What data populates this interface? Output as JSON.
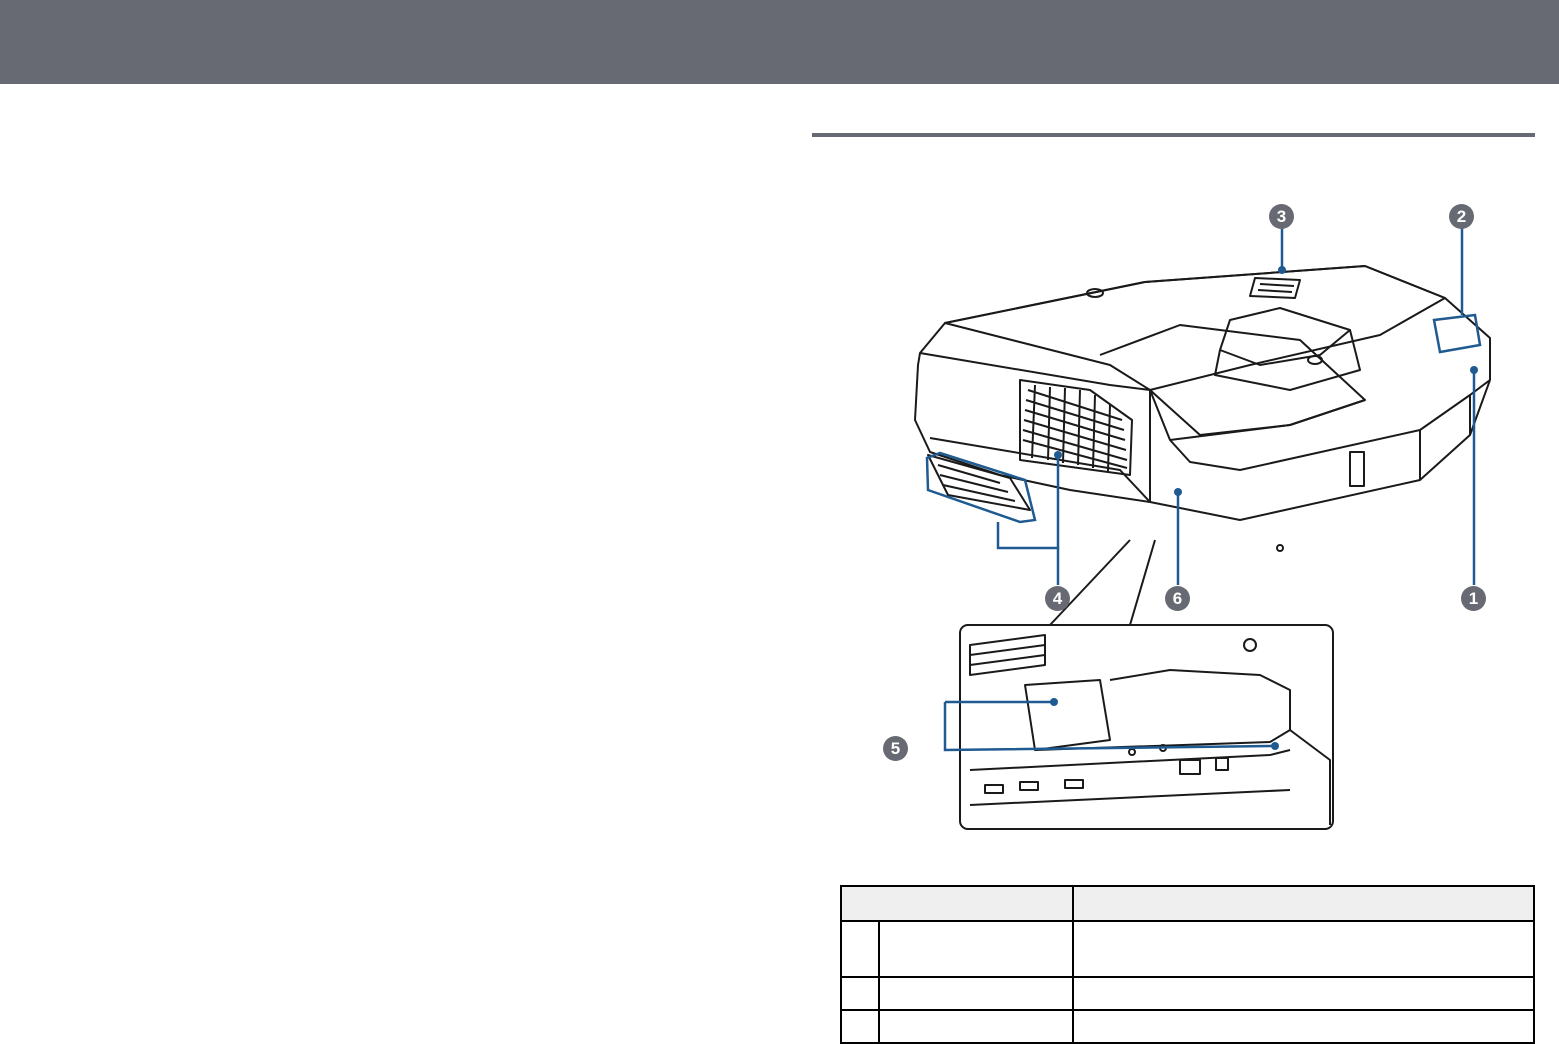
{
  "colors": {
    "header_bar": "#676a72",
    "rule": "#676a72",
    "callout": "#676a72",
    "leader": "#1f5a91",
    "outline": "#1a1a1a"
  },
  "header": {
    "title": ""
  },
  "section": {
    "heading": ""
  },
  "diagram": {
    "callouts": [
      "1",
      "2",
      "3",
      "4",
      "5",
      "6"
    ]
  },
  "table": {
    "headers": [
      "",
      ""
    ],
    "rows": [
      {
        "num": "",
        "name": "",
        "function": ""
      },
      {
        "num": "",
        "name": "",
        "function": ""
      },
      {
        "num": "",
        "name": "",
        "function": ""
      }
    ]
  }
}
